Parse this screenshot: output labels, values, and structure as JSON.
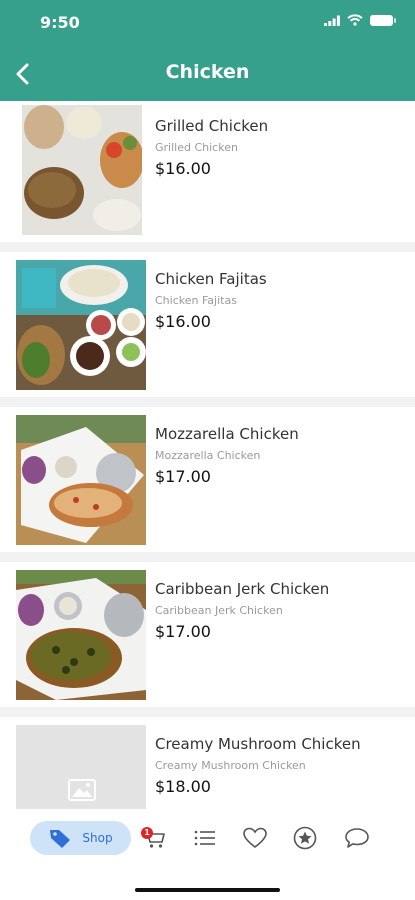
{
  "status_bar": {
    "time": "9:50"
  },
  "header": {
    "title": "Chicken"
  },
  "colors": {
    "header": "#36a08c",
    "shop_pill": "#cfe3f8",
    "shop_text": "#2f6fd6",
    "badge": "#e02424"
  },
  "items": [
    {
      "name": "Grilled Chicken",
      "subtitle": "Grilled Chicken",
      "price": "$16.00"
    },
    {
      "name": "Chicken Fajitas",
      "subtitle": "Chicken Fajitas",
      "price": "$16.00"
    },
    {
      "name": "Mozzarella Chicken",
      "subtitle": "Mozzarella Chicken",
      "price": "$17.00"
    },
    {
      "name": "Caribbean Jerk Chicken",
      "subtitle": "Caribbean Jerk Chicken",
      "price": "$17.00"
    },
    {
      "name": "Creamy Mushroom Chicken",
      "subtitle": "Creamy Mushroom Chicken",
      "price": "$18.00"
    }
  ],
  "tabbar": {
    "shop_label": "Shop",
    "cart_badge": "1",
    "icons": [
      "tag-icon",
      "cart-icon",
      "list-icon",
      "heart-icon",
      "star-icon",
      "chat-icon"
    ]
  }
}
